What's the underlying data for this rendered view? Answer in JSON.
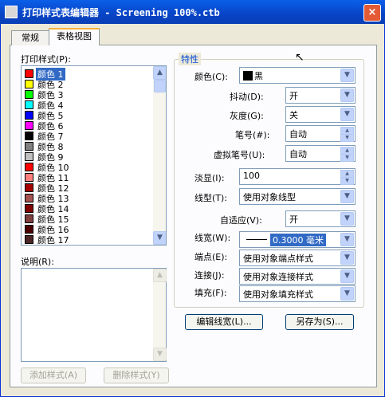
{
  "window": {
    "title": "打印样式表编辑器 - Screening 100%.ctb",
    "close": "×"
  },
  "tabs": [
    {
      "label": "常规"
    },
    {
      "label": "表格视图"
    }
  ],
  "styles": {
    "label": "打印样式(P):",
    "items": [
      {
        "label": "颜色 1",
        "color": "#ff0000"
      },
      {
        "label": "颜色 2",
        "color": "#ffff00"
      },
      {
        "label": "颜色 3",
        "color": "#00ff00"
      },
      {
        "label": "颜色 4",
        "color": "#00ffff"
      },
      {
        "label": "颜色 5",
        "color": "#0000ff"
      },
      {
        "label": "颜色 6",
        "color": "#ff00ff"
      },
      {
        "label": "颜色 7",
        "color": "#000000"
      },
      {
        "label": "颜色 8",
        "color": "#808080"
      },
      {
        "label": "颜色 9",
        "color": "#c0c0c0"
      },
      {
        "label": "颜色 10",
        "color": "#ff0000"
      },
      {
        "label": "颜色 11",
        "color": "#ff7f7f"
      },
      {
        "label": "颜色 12",
        "color": "#a50000"
      },
      {
        "label": "颜色 13",
        "color": "#a55252"
      },
      {
        "label": "颜色 14",
        "color": "#7f0000"
      },
      {
        "label": "颜色 15",
        "color": "#7f3f3f"
      },
      {
        "label": "颜色 16",
        "color": "#4c0000"
      },
      {
        "label": "颜色 17",
        "color": "#4c2626"
      }
    ]
  },
  "description": {
    "label": "说明(R):"
  },
  "buttons": {
    "add_style": "添加样式(A)",
    "delete_style": "删除样式(Y)",
    "edit_lineweight": "编辑线宽(L)...",
    "save_as": "另存为(S)..."
  },
  "properties": {
    "title": "特性",
    "color": {
      "label": "颜色(C):",
      "value": "黑",
      "swatch": "#000000"
    },
    "dither": {
      "label": "抖动(D):",
      "value": "开"
    },
    "grayscale": {
      "label": "灰度(G):",
      "value": "关"
    },
    "pen": {
      "label": "笔号(#):",
      "value": "自动"
    },
    "virtual_pen": {
      "label": "虚拟笔号(U):",
      "value": "自动"
    },
    "screening": {
      "label": "淡显(I):",
      "value": "100"
    },
    "linetype": {
      "label": "线型(T):",
      "value": "使用对象线型"
    },
    "adaptive": {
      "label": "自适应(V):",
      "value": "开"
    },
    "lineweight": {
      "label": "线宽(W):",
      "value": "0.3000 毫米"
    },
    "line_end": {
      "label": "端点(E):",
      "value": "使用对象端点样式"
    },
    "line_join": {
      "label": "连接(J):",
      "value": "使用对象连接样式"
    },
    "fill": {
      "label": "填充(F):",
      "value": "使用对象填充样式"
    }
  }
}
